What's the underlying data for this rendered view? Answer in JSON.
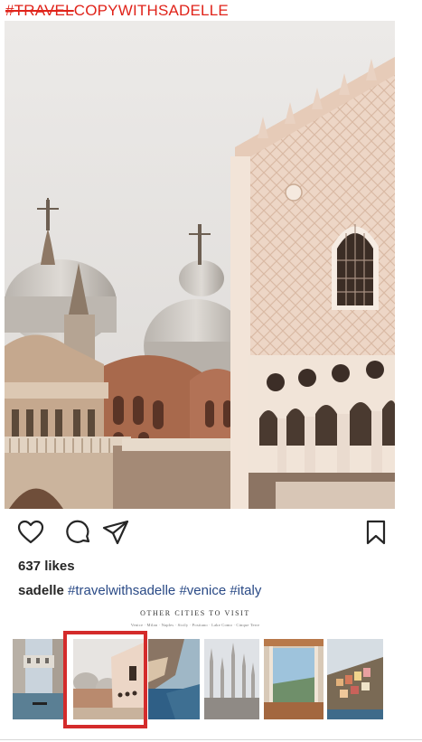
{
  "header": {
    "title_strike": "#TRAVEL",
    "title_rest": "COPYWITHSADELLE"
  },
  "post": {
    "photo_alt": "Venice",
    "likes": "637 likes",
    "username": "sadelle",
    "hashtags": [
      "#travelwithsadelle",
      "#venice",
      "#italy"
    ]
  },
  "icons": {
    "like": "heart-icon",
    "comment": "comment-icon",
    "share": "paper-plane-icon",
    "save": "bookmark-icon"
  },
  "carousel": {
    "title": "OTHER CITIES TO VISIT",
    "cities": "Venice · Milan · Naples · Sicily · Positano · Lake Como · Cinque Terre",
    "thumbnails": [
      "venice-bridge",
      "venice-basilica",
      "positano-cliffs",
      "milan-duomo",
      "lake-como-terrace",
      "cinque-terre"
    ],
    "selected_index": 1
  },
  "colors": {
    "title_red": "#e0231a",
    "highlight_red": "#d42b2b",
    "hashtag_blue": "#2a4a86"
  }
}
